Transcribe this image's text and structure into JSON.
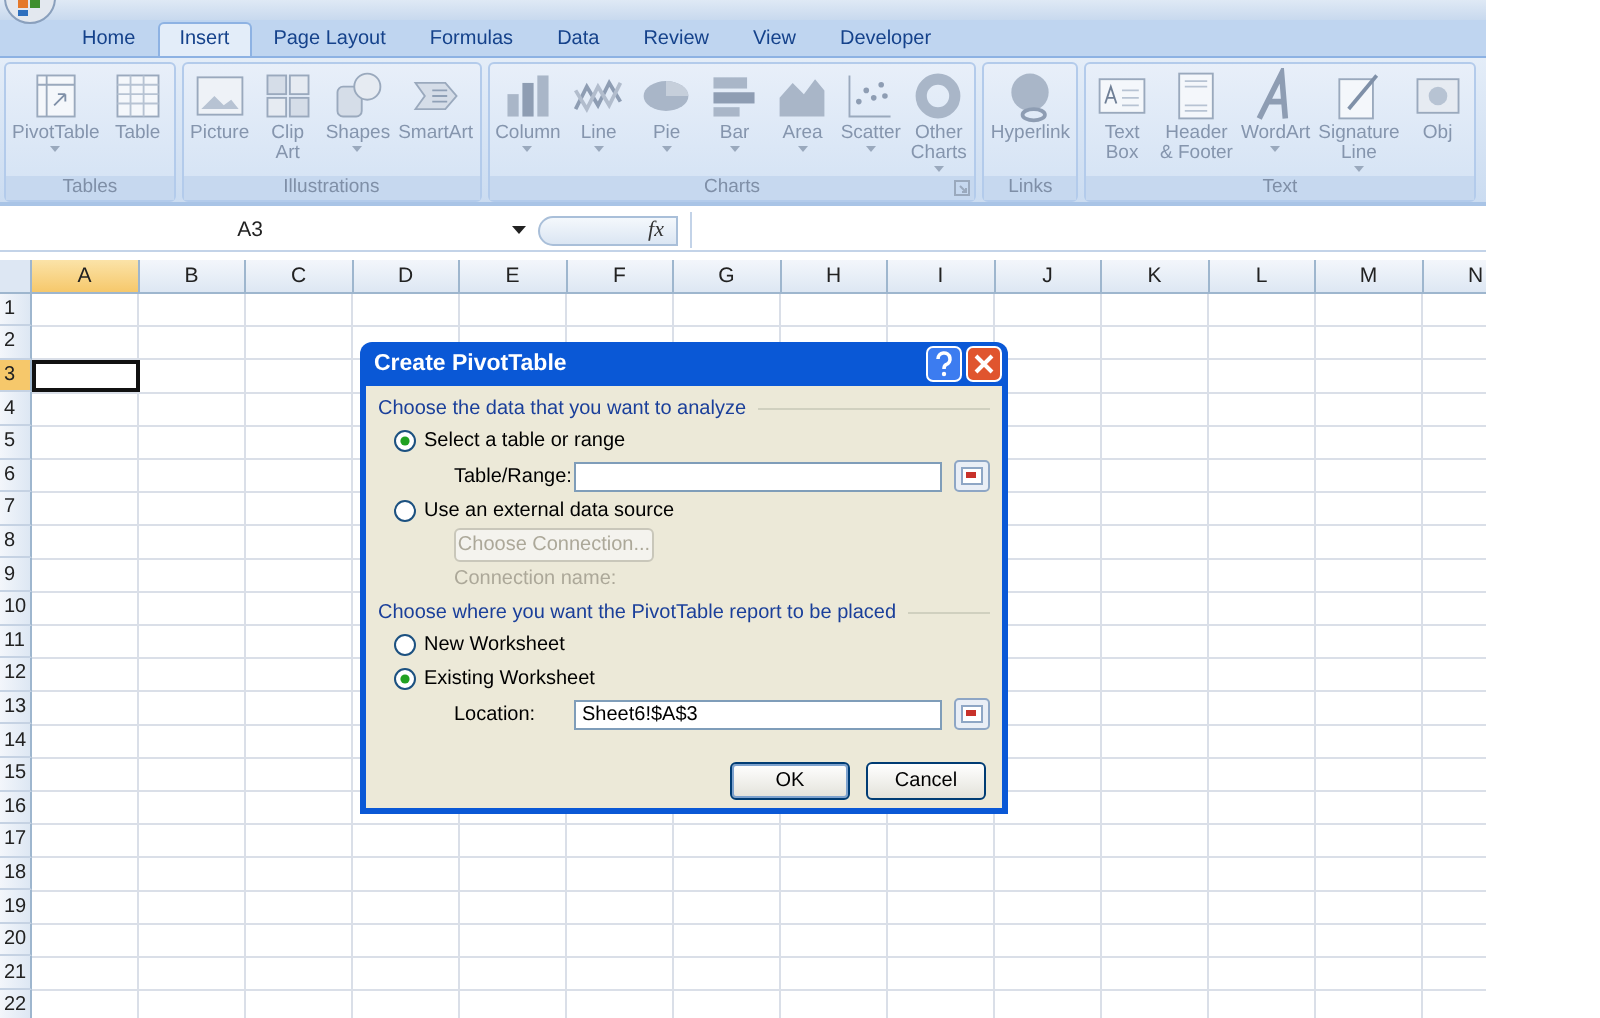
{
  "tabs": [
    {
      "label": "Home",
      "selected": false
    },
    {
      "label": "Insert",
      "selected": true
    },
    {
      "label": "Page Layout",
      "selected": false
    },
    {
      "label": "Formulas",
      "selected": false
    },
    {
      "label": "Data",
      "selected": false
    },
    {
      "label": "Review",
      "selected": false
    },
    {
      "label": "View",
      "selected": false
    },
    {
      "label": "Developer",
      "selected": false
    }
  ],
  "ribbon": {
    "groups": [
      {
        "label": "Tables",
        "launcher": false,
        "items": [
          {
            "kind": "pivot",
            "label": "PivotTable",
            "dropdown": true
          },
          {
            "kind": "table",
            "label": "Table",
            "dropdown": false
          }
        ]
      },
      {
        "label": "Illustrations",
        "launcher": false,
        "items": [
          {
            "kind": "picture",
            "label": "Picture",
            "dropdown": false
          },
          {
            "kind": "clipart",
            "label": "Clip\nArt",
            "dropdown": false
          },
          {
            "kind": "shapes",
            "label": "Shapes",
            "dropdown": true
          },
          {
            "kind": "smartart",
            "label": "SmartArt",
            "dropdown": false
          }
        ]
      },
      {
        "label": "Charts",
        "launcher": true,
        "items": [
          {
            "kind": "column",
            "label": "Column",
            "dropdown": true
          },
          {
            "kind": "line",
            "label": "Line",
            "dropdown": true
          },
          {
            "kind": "pie",
            "label": "Pie",
            "dropdown": true
          },
          {
            "kind": "bar",
            "label": "Bar",
            "dropdown": true
          },
          {
            "kind": "area",
            "label": "Area",
            "dropdown": true
          },
          {
            "kind": "scatter",
            "label": "Scatter",
            "dropdown": true
          },
          {
            "kind": "donut",
            "label": "Other\nCharts",
            "dropdown": true
          }
        ]
      },
      {
        "label": "Links",
        "launcher": false,
        "items": [
          {
            "kind": "globe",
            "label": "Hyperlink",
            "dropdown": false
          }
        ]
      },
      {
        "label": "Text",
        "launcher": false,
        "items": [
          {
            "kind": "textbox",
            "label": "Text\nBox",
            "dropdown": false
          },
          {
            "kind": "page",
            "label": "Header\n& Footer",
            "dropdown": false
          },
          {
            "kind": "wordart",
            "label": "WordArt",
            "dropdown": true
          },
          {
            "kind": "signature",
            "label": "Signature\nLine",
            "dropdown": true
          },
          {
            "kind": "object",
            "label": "Obj",
            "dropdown": false
          }
        ]
      }
    ]
  },
  "name_box": "A3",
  "function_label": "fx",
  "grid": {
    "columns": [
      {
        "label": "A",
        "selected": true
      },
      {
        "label": "B",
        "selected": false
      },
      {
        "label": "C",
        "selected": false
      },
      {
        "label": "D",
        "selected": false
      },
      {
        "label": "E",
        "selected": false
      },
      {
        "label": "F",
        "selected": false
      },
      {
        "label": "G",
        "selected": false
      },
      {
        "label": "H",
        "selected": false
      },
      {
        "label": "I",
        "selected": false
      },
      {
        "label": "J",
        "selected": false
      },
      {
        "label": "K",
        "selected": false
      },
      {
        "label": "L",
        "selected": false
      },
      {
        "label": "M",
        "selected": false
      },
      {
        "label": "N",
        "selected": false
      }
    ],
    "rows": [
      {
        "label": "1",
        "selected": false
      },
      {
        "label": "2",
        "selected": false
      },
      {
        "label": "3",
        "selected": true
      },
      {
        "label": "4",
        "selected": false
      },
      {
        "label": "5",
        "selected": false
      },
      {
        "label": "6",
        "selected": false
      },
      {
        "label": "7",
        "selected": false
      },
      {
        "label": "8",
        "selected": false
      },
      {
        "label": "9",
        "selected": false
      },
      {
        "label": "10",
        "selected": false
      },
      {
        "label": "11",
        "selected": false
      },
      {
        "label": "12",
        "selected": false
      },
      {
        "label": "13",
        "selected": false
      },
      {
        "label": "14",
        "selected": false
      },
      {
        "label": "15",
        "selected": false
      },
      {
        "label": "16",
        "selected": false
      },
      {
        "label": "17",
        "selected": false
      },
      {
        "label": "18",
        "selected": false
      },
      {
        "label": "19",
        "selected": false
      },
      {
        "label": "20",
        "selected": false
      },
      {
        "label": "21",
        "selected": false
      },
      {
        "label": "22",
        "selected": false
      }
    ]
  },
  "dialog": {
    "title": "Create PivotTable",
    "rows": [
      {
        "kind": "heading",
        "label": "Choose the data that you want to analyze"
      },
      {
        "kind": "radio",
        "label": "Select a table or range",
        "selected": true
      },
      {
        "kind": "field",
        "label": "Table/Range:"
      },
      {
        "kind": "radio",
        "label": "Use an external data source",
        "selected": false
      },
      {
        "kind": "button",
        "label": "Choose Connection...",
        "disabled": true
      },
      {
        "kind": "label",
        "label": "Connection name:",
        "disabled": true
      },
      {
        "kind": "heading",
        "label": "Choose where you want the PivotTable report to be placed"
      },
      {
        "kind": "radio",
        "label": "New Worksheet",
        "selected": false
      },
      {
        "kind": "radio",
        "label": "Existing Worksheet",
        "selected": true
      },
      {
        "kind": "field",
        "label": "Location:",
        "value": "Sheet6!$A$3"
      }
    ],
    "buttons": [
      {
        "label": "OK",
        "default": true
      },
      {
        "label": "Cancel",
        "default": false
      }
    ]
  }
}
